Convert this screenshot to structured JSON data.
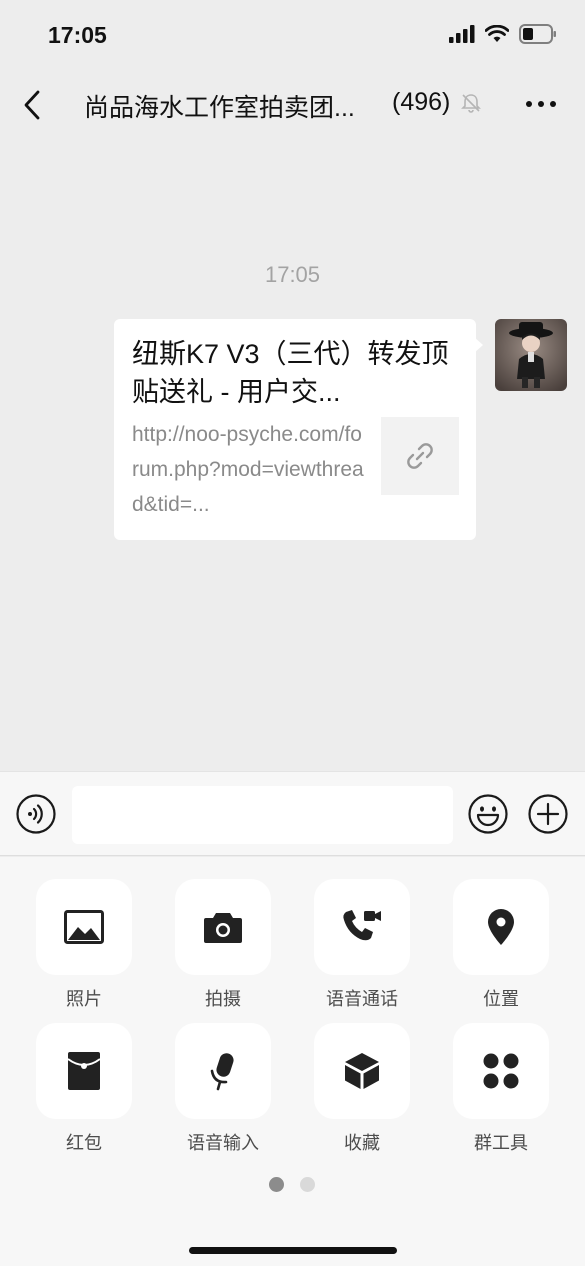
{
  "status": {
    "time": "17:05"
  },
  "nav": {
    "title": "尚品海水工作室拍卖团...",
    "count": "(496)"
  },
  "chat": {
    "timestamp": "17:05",
    "message": {
      "title": "纽斯K7 V3（三代）转发顶贴送礼 - 用户交...",
      "url": "http://noo-psyche.com/forum.php?mod=viewthread&tid=..."
    }
  },
  "tools": [
    {
      "label": "照片",
      "icon": "photo-icon"
    },
    {
      "label": "拍摄",
      "icon": "camera-icon"
    },
    {
      "label": "语音通话",
      "icon": "voice-video-call-icon"
    },
    {
      "label": "位置",
      "icon": "location-icon"
    },
    {
      "label": "红包",
      "icon": "red-packet-icon"
    },
    {
      "label": "语音输入",
      "icon": "microphone-icon"
    },
    {
      "label": "收藏",
      "icon": "favorites-box-icon"
    },
    {
      "label": "群工具",
      "icon": "group-tools-icon"
    }
  ],
  "pager": {
    "active": 0,
    "total": 2
  },
  "colors": {
    "background": "#ededed",
    "panel": "#f7f7f7",
    "icon": "#222222"
  }
}
